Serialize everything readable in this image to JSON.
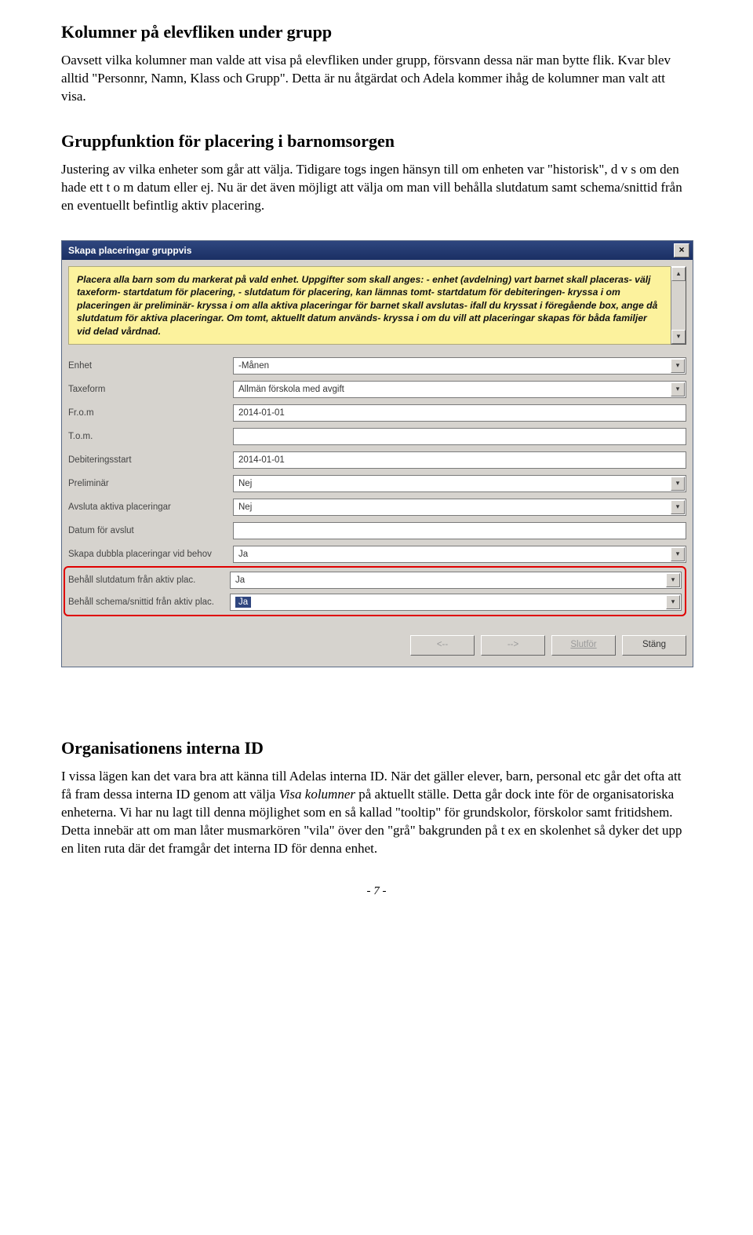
{
  "section1": {
    "title": "Kolumner på elevfliken under grupp",
    "para": "Oavsett vilka kolumner man valde att visa på elevfliken under grupp, försvann dessa när man bytte flik. Kvar blev alltid \"Personnr, Namn, Klass och Grupp\". Detta är nu åtgärdat och Adela kommer ihåg de kolumner man valt att visa."
  },
  "section2": {
    "title": "Gruppfunktion för placering i barnomsorgen",
    "para": "Justering av vilka enheter som går att välja. Tidigare togs ingen hänsyn till om enheten var \"historisk\", d v s om den hade ett t o m datum eller ej. Nu är det även möjligt att välja om man vill behålla slutdatum samt schema/snittid från en eventuellt befintlig aktiv placering."
  },
  "dialog": {
    "title": "Skapa placeringar gruppvis",
    "info": "Placera alla barn som du markerat på vald enhet. Uppgifter som skall anges: - enhet (avdelning) vart barnet skall placeras- välj taxeform- startdatum för placering, - slutdatum för placering, kan lämnas tomt- startdatum för debiteringen- kryssa i om placeringen är preliminär- kryssa i om alla aktiva placeringar för barnet skall avslutas- ifall du kryssat i föregående box, ange då slutdatum för aktiva placeringar. Om tomt, aktuellt datum används- kryssa i om du vill att placeringar skapas för båda familjer vid delad vårdnad.",
    "rows": {
      "enhet": {
        "label": "Enhet",
        "value": "-Månen"
      },
      "taxeform": {
        "label": "Taxeform",
        "value": "Allmän förskola med avgift"
      },
      "from": {
        "label": "Fr.o.m",
        "value": "2014-01-01"
      },
      "tom": {
        "label": "T.o.m.",
        "value": ""
      },
      "debstart": {
        "label": "Debiteringsstart",
        "value": "2014-01-01"
      },
      "preliminar": {
        "label": "Preliminär",
        "value": "Nej"
      },
      "avsluta": {
        "label": "Avsluta aktiva placeringar",
        "value": "Nej"
      },
      "avslutdatum": {
        "label": "Datum för avslut",
        "value": ""
      },
      "dubbla": {
        "label": "Skapa dubbla placeringar vid behov",
        "value": "Ja"
      },
      "behallslut": {
        "label": "Behåll slutdatum från aktiv plac.",
        "value": "Ja"
      },
      "behallschema": {
        "label": "Behåll schema/snittid från aktiv plac.",
        "value": "Ja"
      }
    },
    "buttons": {
      "back": "<--",
      "next": "-->",
      "finish": "Slutför",
      "close": "Stäng"
    }
  },
  "section3": {
    "title": "Organisationens interna ID",
    "para_pre": "I vissa lägen kan det vara bra att känna till Adelas interna ID. När det gäller elever, barn, personal etc går det ofta att få fram dessa interna ID genom att välja ",
    "para_em": "Visa kolumner",
    "para_post": " på aktuellt ställe. Detta går dock inte för de organisatoriska enheterna. Vi har nu lagt till denna möjlighet som en så kallad \"tooltip\" för grundskolor, förskolor samt fritidshem. Detta innebär att om man låter musmarkören \"vila\" över den \"grå\" bakgrunden på t ex en skolenhet så dyker det upp en liten ruta där det framgår det interna ID för denna enhet."
  },
  "footer": "- 7 -"
}
